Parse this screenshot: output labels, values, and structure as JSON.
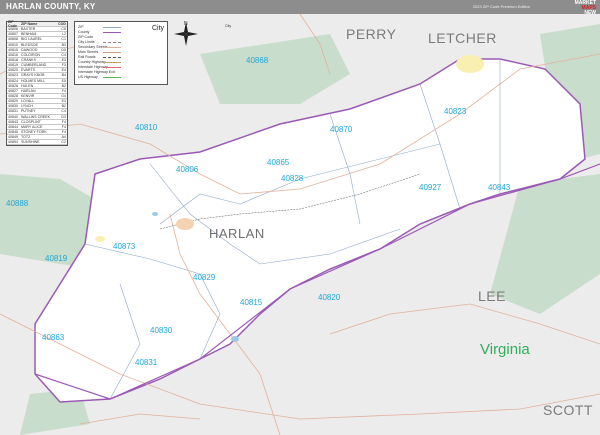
{
  "header": {
    "title": "HARLAN COUNTY, KY",
    "edition": "2023 ZIP Code Premium Edition",
    "brand_line1": "MARKET",
    "brand_line2": "MAPS",
    "brand_line3": "NEW"
  },
  "zip_table": {
    "headers": [
      "ZIP Code",
      "ZIP Name",
      "COD"
    ],
    "rows": [
      [
        "40806",
        "BAXTER",
        "C5"
      ],
      [
        "40807",
        "BENHAM",
        "L2"
      ],
      [
        "40808",
        "BIG LAUREL",
        "C1"
      ],
      [
        "40810",
        "BLEDSOE",
        "B3"
      ],
      [
        "40815",
        "CAWOOD",
        "D5"
      ],
      [
        "40816",
        "COLDIRON",
        "C4"
      ],
      [
        "40818",
        "CRANKS",
        "E3"
      ],
      [
        "40819",
        "CUMBERLAND",
        "F3"
      ],
      [
        "40820",
        "EVARTS",
        "E4"
      ],
      [
        "40823",
        "GRAYS KNOB",
        "B4"
      ],
      [
        "40824",
        "HOLMES MILL",
        "E5"
      ],
      [
        "40826",
        "HULEN",
        "B2"
      ],
      [
        "40827",
        "HARLAN",
        "F4"
      ],
      [
        "40828",
        "KENVIR",
        "G4"
      ],
      [
        "40829",
        "LOYALL",
        "E3"
      ],
      [
        "40830",
        "LYNCH",
        "B2"
      ],
      [
        "40831",
        "PUTNEY",
        "C4"
      ],
      [
        "40840",
        "WALLINS CREEK",
        "D3"
      ],
      [
        "40843",
        "CLOSPLINT",
        "F4"
      ],
      [
        "40844",
        "MARY ALICE",
        "F4"
      ],
      [
        "40845",
        "STONEY FORK",
        "F4"
      ],
      [
        "40849",
        "TOTZ",
        "A4"
      ],
      [
        "40854",
        "SUNSHINE",
        "C2"
      ]
    ]
  },
  "legend": {
    "items": [
      "ZIP",
      "County",
      "ZIP Code",
      "City Limits",
      "Secondary Streets",
      "Main Streets",
      "Rail Roads",
      "Country Highway",
      "Interstate Highway",
      "Interstate Highway Exit",
      "US Highway"
    ],
    "city_word": "City",
    "city_sample": "City",
    "compass_n": "N"
  },
  "labels": {
    "regions": [
      "PERRY",
      "LETCHER",
      "LEE",
      "SCOTT"
    ],
    "county": "HARLAN",
    "state": "Virginia",
    "zips": [
      "40868",
      "40810",
      "40870",
      "40865",
      "40823",
      "40806",
      "40828",
      "40927",
      "40843",
      "40888",
      "40873",
      "40819",
      "40829",
      "40815",
      "40820",
      "40830",
      "40863",
      "40831"
    ]
  },
  "colors": {
    "county_fill": "#ffffff",
    "outside_fill": "#ececec",
    "forest": "#c9ddcc",
    "zip_label": "#1ea7d6",
    "road": "#e0b29a",
    "state_line": "#9b59b6",
    "header_bar": "#8d8d8d"
  }
}
